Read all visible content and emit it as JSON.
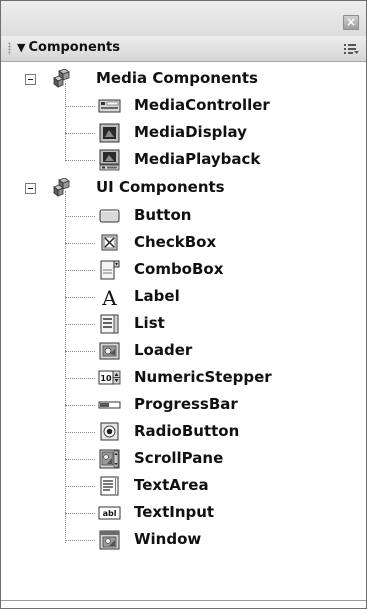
{
  "panel": {
    "title": "Components",
    "close_icon": "close-icon",
    "menu_icon": "panel-options-icon"
  },
  "tree": {
    "groups": [
      {
        "label": "Media Components",
        "icon": "component-group-icon",
        "expanded": true,
        "items": [
          {
            "label": "MediaController",
            "icon": "media-controller-icon"
          },
          {
            "label": "MediaDisplay",
            "icon": "media-display-icon"
          },
          {
            "label": "MediaPlayback",
            "icon": "media-playback-icon"
          }
        ]
      },
      {
        "label": "UI Components",
        "icon": "component-group-icon",
        "expanded": true,
        "items": [
          {
            "label": "Button",
            "icon": "button-icon"
          },
          {
            "label": "CheckBox",
            "icon": "checkbox-icon"
          },
          {
            "label": "ComboBox",
            "icon": "combobox-icon"
          },
          {
            "label": "Label",
            "icon": "label-icon"
          },
          {
            "label": "List",
            "icon": "list-icon"
          },
          {
            "label": "Loader",
            "icon": "loader-icon"
          },
          {
            "label": "NumericStepper",
            "icon": "numeric-stepper-icon"
          },
          {
            "label": "ProgressBar",
            "icon": "progress-bar-icon"
          },
          {
            "label": "RadioButton",
            "icon": "radio-button-icon"
          },
          {
            "label": "ScrollPane",
            "icon": "scroll-pane-icon"
          },
          {
            "label": "TextArea",
            "icon": "text-area-icon"
          },
          {
            "label": "TextInput",
            "icon": "text-input-icon"
          },
          {
            "label": "Window",
            "icon": "window-icon"
          }
        ]
      }
    ]
  },
  "icon_glyphs": {
    "label_icon_text": "A",
    "numeric_stepper_icon_text": "10",
    "text_input_icon_text": "abl"
  }
}
